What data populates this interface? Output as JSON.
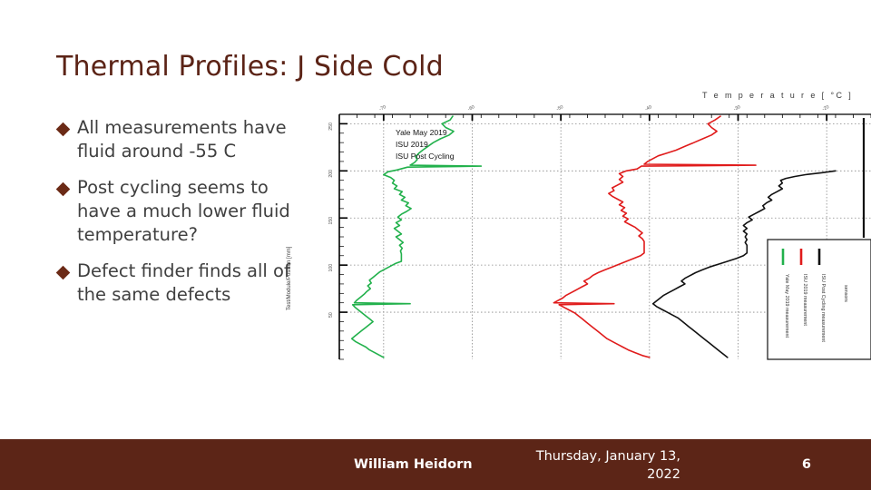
{
  "slide": {
    "title": "Thermal Profiles:  J Side Cold",
    "title_color": "#5b2316",
    "accent_color": "#5c2517",
    "background": "#ffffff"
  },
  "bullets": [
    {
      "marker": "diamond-bullet",
      "text": "All measurements have fluid around -55 C"
    },
    {
      "marker": "diamond-bullet",
      "text": "Post cycling seems to have a much lower fluid temperature?"
    },
    {
      "marker": "diamond-bullet",
      "text": "Defect finder finds all of the same defects"
    }
  ],
  "footer": {
    "author": "William Heidorn",
    "date": "Thursday, January 13, 2022",
    "page_number": "6"
  },
  "chart_data": {
    "type": "line",
    "title": "T e m p e r a t u r e   [ °C ]",
    "xlabel": "Temperature [°C]",
    "ylabel": "Test/Module/Position [mm]",
    "x_axis_position": "top",
    "grid": true,
    "xlim": [
      -75,
      -15
    ],
    "ylim": [
      0,
      260
    ],
    "xticks": [
      "-70",
      "-60",
      "-50",
      "-40",
      "-30",
      "-20"
    ],
    "yticks": [
      "250",
      "200",
      "150",
      "100",
      "50"
    ],
    "legend_position": "top-right",
    "legend": [
      {
        "name": "Yale May 2019",
        "color": "#22b14c"
      },
      {
        "name": "ISU 2019",
        "color": "#e01b1b"
      },
      {
        "name": "ISU Post Cycling",
        "color": "#111111"
      }
    ],
    "legend_box": [
      {
        "color": "#22b14c",
        "label": "Yale May 2019 measurement"
      },
      {
        "color": "#e01b1b",
        "label": "ISU 2019 measurement"
      },
      {
        "color": "#111111",
        "label": "ISU Post Cycling measurement"
      },
      {
        "color": "",
        "label": "sensors"
      }
    ],
    "series": [
      {
        "name": "Yale May 2019",
        "color": "#22b14c",
        "points": [
          [
            -62.2,
            258
          ],
          [
            -62.5,
            254
          ],
          [
            -63.4,
            250
          ],
          [
            -63.0,
            246
          ],
          [
            -62.1,
            242
          ],
          [
            -62.6,
            238
          ],
          [
            -63.6,
            234
          ],
          [
            -64.4,
            230
          ],
          [
            -65.0,
            226
          ],
          [
            -65.6,
            222
          ],
          [
            -66.0,
            219
          ],
          [
            -66.4,
            215
          ],
          [
            -66.2,
            212
          ],
          [
            -66.5,
            209
          ],
          [
            -67.0,
            206
          ],
          [
            -59.0,
            205
          ],
          [
            -67.3,
            204
          ],
          [
            -68.5,
            201
          ],
          [
            -69.5,
            199
          ],
          [
            -70.0,
            196
          ],
          [
            -69.2,
            193
          ],
          [
            -68.8,
            190
          ],
          [
            -69.0,
            187
          ],
          [
            -68.5,
            184
          ],
          [
            -68.8,
            181
          ],
          [
            -67.9,
            178
          ],
          [
            -68.2,
            175
          ],
          [
            -67.6,
            172
          ],
          [
            -68.0,
            169
          ],
          [
            -67.2,
            166
          ],
          [
            -67.5,
            163
          ],
          [
            -66.9,
            160
          ],
          [
            -67.4,
            157
          ],
          [
            -68.0,
            154
          ],
          [
            -68.4,
            151
          ],
          [
            -68.0,
            148
          ],
          [
            -68.6,
            145
          ],
          [
            -68.2,
            142
          ],
          [
            -68.8,
            139
          ],
          [
            -68.4,
            136
          ],
          [
            -68.0,
            133
          ],
          [
            -68.6,
            130
          ],
          [
            -68.2,
            127
          ],
          [
            -67.8,
            124
          ],
          [
            -68.2,
            121
          ],
          [
            -67.9,
            118
          ],
          [
            -68.1,
            115
          ],
          [
            -68.0,
            112
          ],
          [
            -68.0,
            108
          ],
          [
            -68.0,
            104
          ],
          [
            -68.6,
            102
          ],
          [
            -69.2,
            99
          ],
          [
            -69.8,
            96
          ],
          [
            -70.4,
            93
          ],
          [
            -70.8,
            90
          ],
          [
            -71.2,
            87
          ],
          [
            -71.6,
            84
          ],
          [
            -71.4,
            81
          ],
          [
            -71.8,
            78
          ],
          [
            -71.5,
            75
          ],
          [
            -71.9,
            72
          ],
          [
            -72.2,
            69
          ],
          [
            -72.6,
            66
          ],
          [
            -73.0,
            63
          ],
          [
            -73.3,
            60
          ],
          [
            -67.0,
            59
          ],
          [
            -73.5,
            58
          ],
          [
            -73.2,
            55
          ],
          [
            -72.8,
            52
          ],
          [
            -72.4,
            49
          ],
          [
            -72.0,
            46
          ],
          [
            -71.6,
            43
          ],
          [
            -71.2,
            40
          ],
          [
            -71.6,
            37
          ],
          [
            -72.0,
            34
          ],
          [
            -72.4,
            31
          ],
          [
            -72.8,
            28
          ],
          [
            -73.2,
            25
          ],
          [
            -73.6,
            22
          ],
          [
            -73.2,
            19
          ],
          [
            -72.6,
            16
          ],
          [
            -72.0,
            13
          ],
          [
            -71.6,
            10
          ],
          [
            -71.0,
            7
          ],
          [
            -70.4,
            4
          ],
          [
            -70.0,
            2
          ]
        ]
      },
      {
        "name": "ISU 2019",
        "color": "#e01b1b",
        "points": [
          [
            -32.0,
            258
          ],
          [
            -32.6,
            254
          ],
          [
            -33.4,
            250
          ],
          [
            -33.0,
            246
          ],
          [
            -32.4,
            242
          ],
          [
            -33.0,
            238
          ],
          [
            -34.0,
            234
          ],
          [
            -35.0,
            230
          ],
          [
            -36.0,
            226
          ],
          [
            -37.0,
            222
          ],
          [
            -38.0,
            219
          ],
          [
            -39.0,
            216
          ],
          [
            -39.6,
            213
          ],
          [
            -40.2,
            210
          ],
          [
            -40.6,
            207
          ],
          [
            -28.0,
            206
          ],
          [
            -40.9,
            205
          ],
          [
            -41.4,
            202
          ],
          [
            -42.6,
            200
          ],
          [
            -43.4,
            197
          ],
          [
            -43.0,
            194
          ],
          [
            -43.4,
            191
          ],
          [
            -43.0,
            188
          ],
          [
            -43.6,
            185
          ],
          [
            -44.2,
            182
          ],
          [
            -44.0,
            179
          ],
          [
            -44.6,
            176
          ],
          [
            -44.2,
            173
          ],
          [
            -43.6,
            170
          ],
          [
            -43.0,
            167
          ],
          [
            -43.4,
            164
          ],
          [
            -42.8,
            161
          ],
          [
            -43.2,
            158
          ],
          [
            -42.6,
            155
          ],
          [
            -43.0,
            152
          ],
          [
            -42.4,
            149
          ],
          [
            -42.8,
            146
          ],
          [
            -42.2,
            143
          ],
          [
            -41.6,
            140
          ],
          [
            -41.2,
            137
          ],
          [
            -40.8,
            134
          ],
          [
            -41.2,
            131
          ],
          [
            -40.8,
            128
          ],
          [
            -40.6,
            125
          ],
          [
            -40.6,
            121
          ],
          [
            -40.6,
            117
          ],
          [
            -40.6,
            113
          ],
          [
            -41.0,
            110
          ],
          [
            -41.8,
            107
          ],
          [
            -42.6,
            104
          ],
          [
            -43.4,
            101
          ],
          [
            -44.2,
            98
          ],
          [
            -45.0,
            95
          ],
          [
            -45.8,
            92
          ],
          [
            -46.4,
            89
          ],
          [
            -46.8,
            86
          ],
          [
            -47.4,
            83
          ],
          [
            -47.0,
            80
          ],
          [
            -47.6,
            77
          ],
          [
            -48.2,
            74
          ],
          [
            -48.8,
            71
          ],
          [
            -49.4,
            68
          ],
          [
            -49.8,
            65
          ],
          [
            -50.4,
            62
          ],
          [
            -50.8,
            60
          ],
          [
            -44.0,
            59
          ],
          [
            -50.2,
            58
          ],
          [
            -49.6,
            55
          ],
          [
            -49.0,
            52
          ],
          [
            -48.4,
            49
          ],
          [
            -48.0,
            46
          ],
          [
            -47.6,
            43
          ],
          [
            -47.2,
            40
          ],
          [
            -46.8,
            37
          ],
          [
            -46.4,
            34
          ],
          [
            -46.0,
            31
          ],
          [
            -45.6,
            28
          ],
          [
            -45.2,
            25
          ],
          [
            -44.8,
            22
          ],
          [
            -44.2,
            19
          ],
          [
            -43.6,
            16
          ],
          [
            -43.0,
            13
          ],
          [
            -42.4,
            10
          ],
          [
            -41.6,
            7
          ],
          [
            -40.8,
            4
          ],
          [
            -40.0,
            2
          ]
        ]
      },
      {
        "name": "ISU Post Cycling",
        "color": "#111111",
        "points": [
          [
            -19.0,
            200
          ],
          [
            -20.6,
            198
          ],
          [
            -22.4,
            196
          ],
          [
            -23.6,
            194
          ],
          [
            -24.6,
            192
          ],
          [
            -25.2,
            190
          ],
          [
            -25.0,
            187
          ],
          [
            -25.4,
            184
          ],
          [
            -25.0,
            181
          ],
          [
            -25.6,
            178
          ],
          [
            -26.2,
            175
          ],
          [
            -26.6,
            172
          ],
          [
            -26.2,
            169
          ],
          [
            -26.8,
            166
          ],
          [
            -27.2,
            163
          ],
          [
            -27.0,
            160
          ],
          [
            -27.6,
            157
          ],
          [
            -28.2,
            154
          ],
          [
            -28.8,
            151
          ],
          [
            -28.4,
            148
          ],
          [
            -29.0,
            145
          ],
          [
            -29.4,
            142
          ],
          [
            -29.0,
            139
          ],
          [
            -29.4,
            136
          ],
          [
            -29.0,
            133
          ],
          [
            -29.2,
            130
          ],
          [
            -29.0,
            127
          ],
          [
            -29.2,
            124
          ],
          [
            -29.0,
            121
          ],
          [
            -29.0,
            117
          ],
          [
            -29.0,
            113
          ],
          [
            -29.4,
            110
          ],
          [
            -30.2,
            107
          ],
          [
            -31.2,
            104
          ],
          [
            -32.2,
            101
          ],
          [
            -33.2,
            98
          ],
          [
            -34.0,
            95
          ],
          [
            -34.8,
            92
          ],
          [
            -35.4,
            89
          ],
          [
            -36.0,
            86
          ],
          [
            -36.4,
            83
          ],
          [
            -36.0,
            80
          ],
          [
            -36.6,
            77
          ],
          [
            -37.2,
            74
          ],
          [
            -37.8,
            71
          ],
          [
            -38.4,
            68
          ],
          [
            -38.8,
            65
          ],
          [
            -39.2,
            62
          ],
          [
            -39.6,
            59
          ],
          [
            -39.2,
            56
          ],
          [
            -38.6,
            53
          ],
          [
            -38.0,
            50
          ],
          [
            -37.4,
            47
          ],
          [
            -36.8,
            44
          ],
          [
            -36.4,
            41
          ],
          [
            -36.0,
            38
          ],
          [
            -35.6,
            35
          ],
          [
            -35.2,
            32
          ],
          [
            -34.8,
            29
          ],
          [
            -34.4,
            26
          ],
          [
            -34.0,
            23
          ],
          [
            -33.6,
            20
          ],
          [
            -33.2,
            17
          ],
          [
            -32.8,
            14
          ],
          [
            -32.4,
            11
          ],
          [
            -32.0,
            8
          ],
          [
            -31.6,
            5
          ],
          [
            -31.2,
            2
          ]
        ]
      }
    ]
  }
}
